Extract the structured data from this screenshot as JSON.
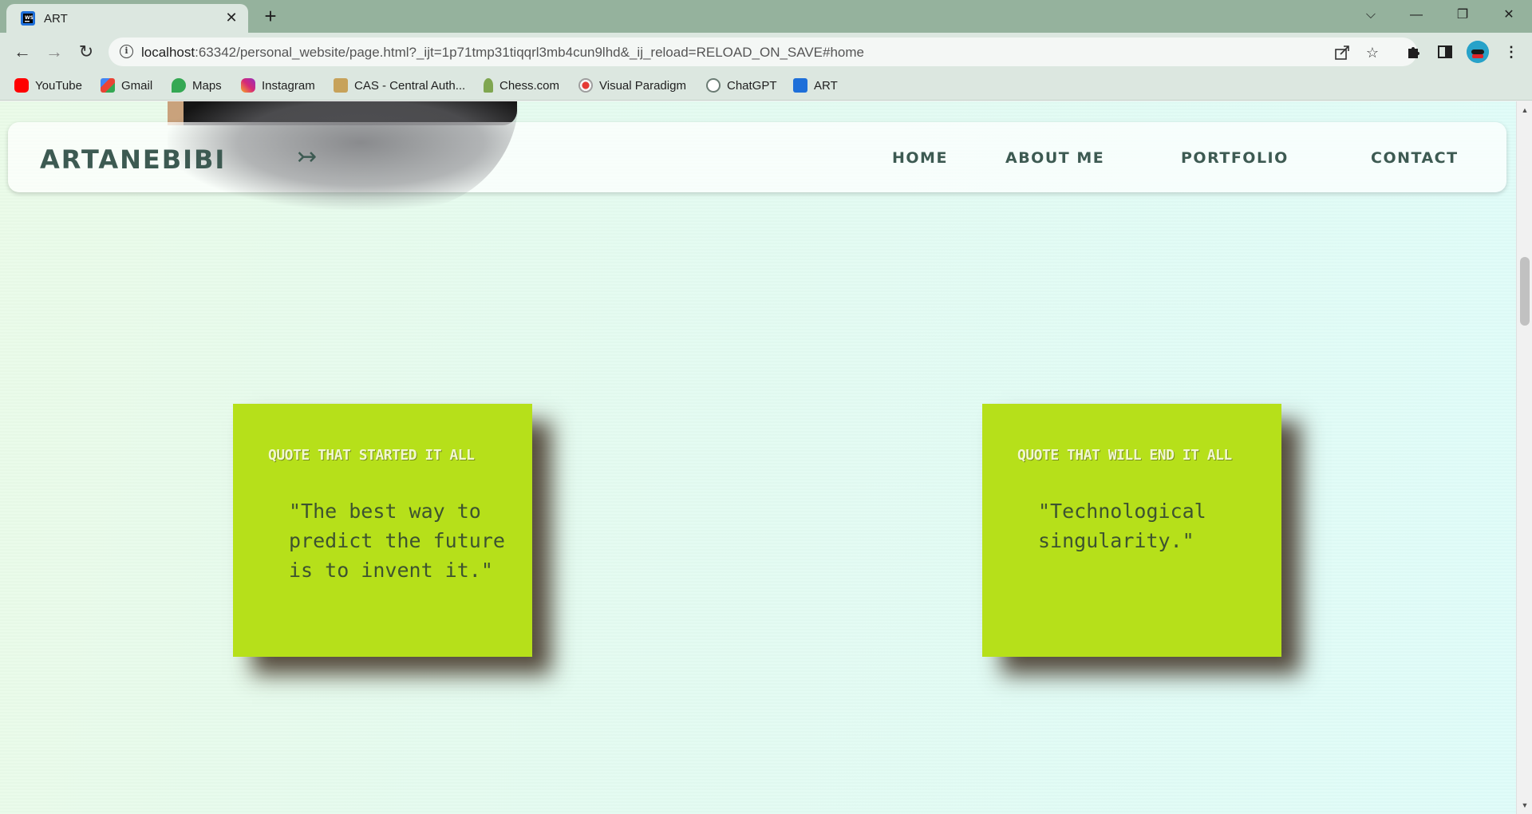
{
  "browser": {
    "tab": {
      "title": "ART",
      "close": "✕"
    },
    "new_tab": "+",
    "window": {
      "dropdown": "⌵",
      "minimize": "—",
      "restore": "❐",
      "close": "✕"
    },
    "nav": {
      "back": "←",
      "forward": "→",
      "reload": "↻"
    },
    "url": {
      "host": "localhost",
      "rest": ":63342/personal_website/page.html?_ijt=1p71tmp31tiqqrl3mb4cun9lhd&_ij_reload=RELOAD_ON_SAVE#home"
    },
    "bookmarks": [
      {
        "label": "YouTube",
        "icon": "youtube-icon",
        "color": "#ff0000"
      },
      {
        "label": "Gmail",
        "icon": "gmail-icon",
        "color": "#ea4335"
      },
      {
        "label": "Maps",
        "icon": "maps-icon",
        "color": "#34a853"
      },
      {
        "label": "Instagram",
        "icon": "instagram-icon",
        "color": "#d62976"
      },
      {
        "label": "CAS - Central Auth...",
        "icon": "cas-icon",
        "color": "#c7a25a"
      },
      {
        "label": "Chess.com",
        "icon": "chess-icon",
        "color": "#7fa650"
      },
      {
        "label": "Visual Paradigm",
        "icon": "visual-paradigm-icon",
        "color": "#e53935"
      },
      {
        "label": "ChatGPT",
        "icon": "chatgpt-icon",
        "color": "#6b7c74"
      },
      {
        "label": "ART",
        "icon": "art-icon",
        "color": "#1e6fd9"
      }
    ]
  },
  "site": {
    "logo": "ARTANEBIBI",
    "logo_arrow": "↣",
    "nav": {
      "home": "HOME",
      "about": "ABOUT ME",
      "portfolio": "PORTFOLIO",
      "contact": "CONTACT"
    },
    "cards": [
      {
        "heading": "QUOTE THAT STARTED IT ALL",
        "quote": "\"The best way to predict the future is to invent it.\""
      },
      {
        "heading": "QUOTE THAT WILL END IT ALL",
        "quote": "\"Technological singularity.\""
      }
    ]
  },
  "colors": {
    "card": "#b6e01a",
    "brand_text": "#3d5a52",
    "tabbar": "#95b29d",
    "toolbar": "#dce7e0"
  }
}
